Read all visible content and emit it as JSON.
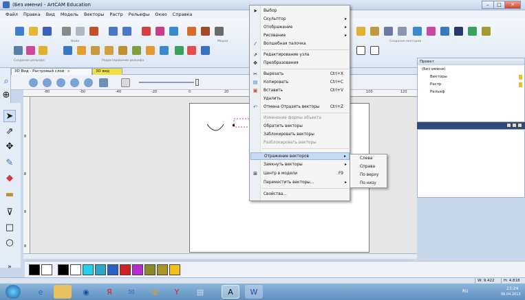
{
  "window": {
    "title": "(Без имени) - ArtCAM Education"
  },
  "menu_bar": [
    "Файл",
    "Правка",
    "Вид",
    "Модель",
    "Векторы",
    "Растр",
    "Рельефы",
    "Окно",
    "Справка"
  ],
  "ribbon": {
    "group_labels": [
      "Файл",
      "Создание векторов",
      "Создание рельефа",
      "Редактирование рельефа",
      "Модел"
    ]
  },
  "tabs": [
    {
      "label": "3D Вид - Растровый слой"
    },
    {
      "label": "3D вид"
    }
  ],
  "ruler_ticks": [
    "-80",
    "-60",
    "-40",
    "-20",
    "0",
    "20",
    "100",
    "120"
  ],
  "project_panel": {
    "title": "Проект",
    "tree": [
      "(Без имени)",
      "Векторы",
      "Растр",
      "Рельеф"
    ]
  },
  "context_menu": {
    "items": [
      {
        "label": "Выбор",
        "icon": "cursor-icon",
        "arrow": false
      },
      {
        "label": "Скульптор",
        "arrow": true
      },
      {
        "label": "Отображение",
        "arrow": true
      },
      {
        "label": "Рисование",
        "arrow": true
      },
      {
        "label": "Волшебная палочка",
        "icon": "wand-icon"
      },
      {
        "label": "Редактирование узла",
        "icon": "node-edit-icon"
      },
      {
        "label": "Преобразования",
        "icon": "transform-icon"
      },
      {
        "label": "Вырезать",
        "shortcut": "Ctrl+X",
        "icon": "scissors-icon"
      },
      {
        "label": "Копировать",
        "shortcut": "Ctrl+C",
        "icon": "copy-icon"
      },
      {
        "label": "Вставить",
        "shortcut": "Ctrl+V",
        "icon": "paste-icon"
      },
      {
        "label": "Удалить"
      },
      {
        "label": "Отмена Отразить векторы",
        "shortcut": "Ctrl+Z",
        "icon": "undo-icon"
      },
      {
        "label": "Изменение формы объекта",
        "disabled": true
      },
      {
        "label": "Обратить векторы"
      },
      {
        "label": "Заблокировать векторы"
      },
      {
        "label": "Разблокировать векторы",
        "disabled": true
      },
      {
        "label": "Отражение векторов",
        "arrow": true,
        "highlighted": true
      },
      {
        "label": "Замкнуть векторы",
        "arrow": true
      },
      {
        "label": "Центр в модели",
        "shortcut": "F9",
        "icon": "center-icon"
      },
      {
        "label": "Переместить векторы...",
        "arrow": true
      },
      {
        "label": "Свойства..."
      }
    ]
  },
  "submenu": {
    "items": [
      "Слева",
      "Справа",
      "По верху",
      "По низу"
    ]
  },
  "palette": [
    "#000000",
    "#ffffff",
    "#22d3ee",
    "#2aa7c7",
    "#2a62c9",
    "#d32020",
    "#b52fd0",
    "#8a8a2a",
    "#a8962a",
    "#f3c019"
  ],
  "status": {
    "w": "W: 9.422",
    "h": "H: 4.818"
  },
  "clock": {
    "time": "23:24",
    "date": "06.04.2013"
  },
  "tray": {
    "lang": "RU"
  }
}
